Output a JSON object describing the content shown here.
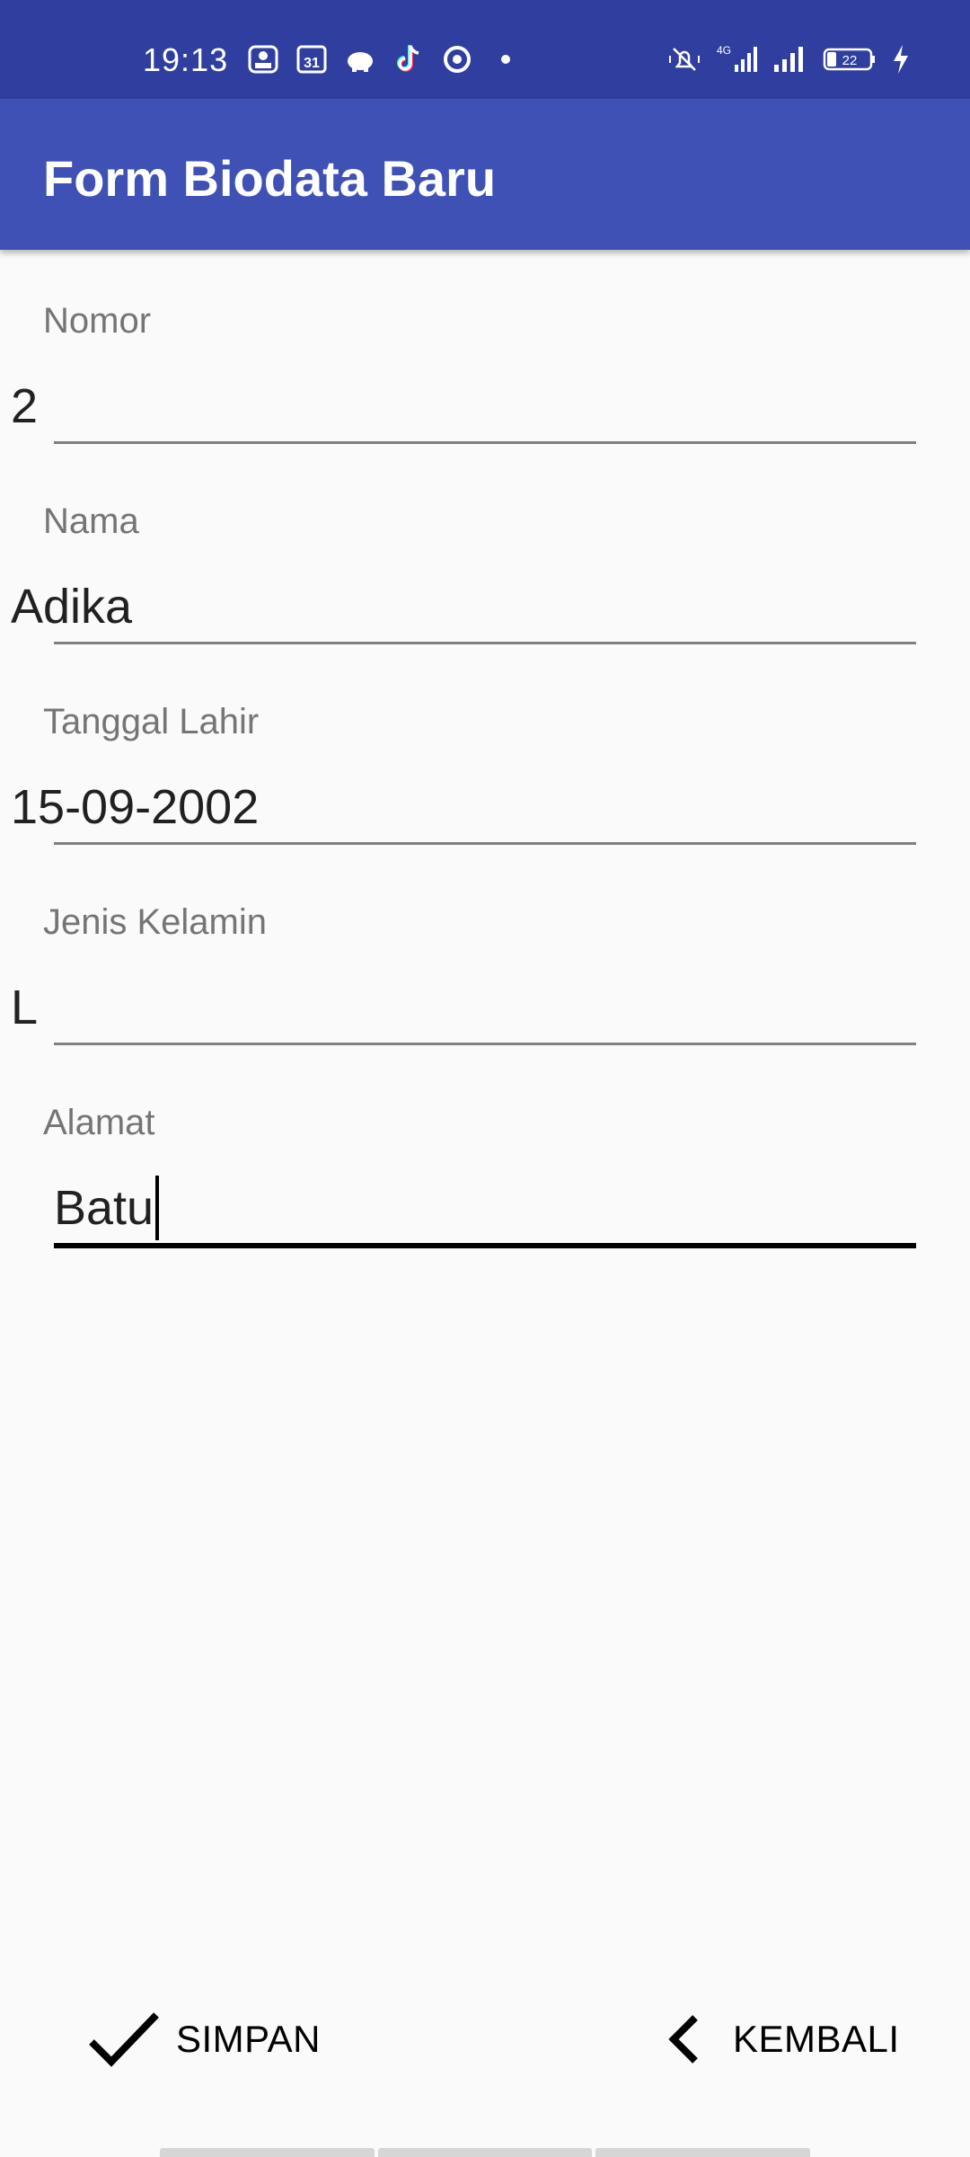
{
  "status_bar": {
    "time": "19:13",
    "left_icons": [
      "ticket-app-icon",
      "calendar-icon",
      "piggy-bank-icon",
      "tiktok-icon",
      "circle-app-icon",
      "dot-icon"
    ],
    "calendar_day": "31",
    "right_icons": [
      "vibrate-mute-icon",
      "signal-4g-icon",
      "signal-icon",
      "battery-icon",
      "charging-icon"
    ],
    "network_type": "4G",
    "battery_level": "22"
  },
  "app_bar": {
    "title": "Form Biodata Baru"
  },
  "form": {
    "fields": [
      {
        "label": "Nomor",
        "value": "2"
      },
      {
        "label": "Nama",
        "value": "Adika"
      },
      {
        "label": "Tanggal Lahir",
        "value": "15-09-2002"
      },
      {
        "label": "Jenis Kelamin",
        "value": "L"
      },
      {
        "label": "Alamat",
        "value": "Batu"
      }
    ]
  },
  "buttons": {
    "save_label": "SIMPAN",
    "back_label": "KEMBALI"
  },
  "colors": {
    "status_bar": "#303f9f",
    "app_bar": "#3f51b5",
    "background": "#fafafa"
  }
}
